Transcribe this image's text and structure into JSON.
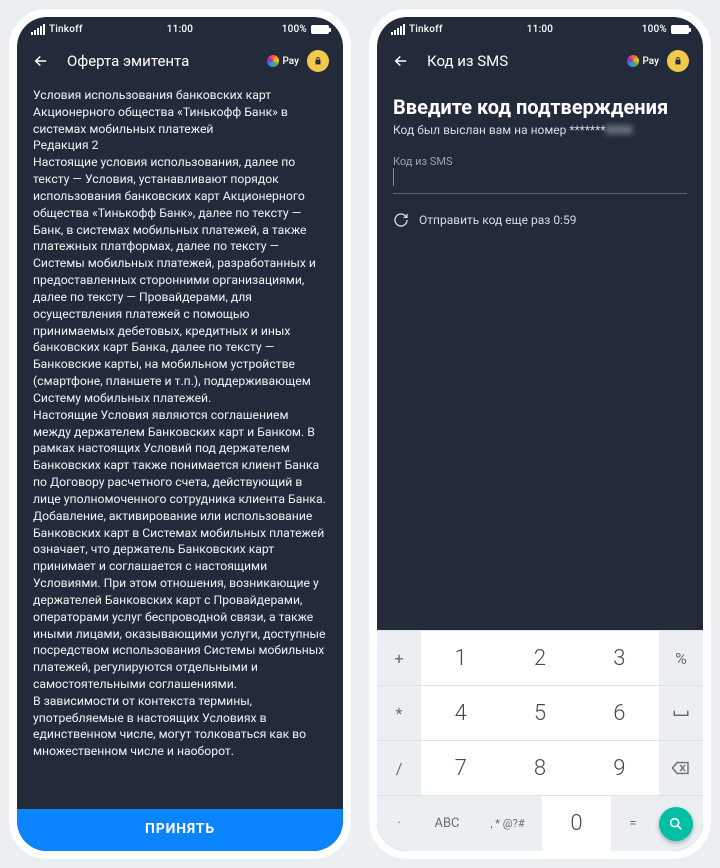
{
  "statusbar": {
    "carrier": "Tinkoff",
    "time": "11:00",
    "battery": "100%"
  },
  "left": {
    "title": "Оферта эмитента",
    "pay_label": "Pay",
    "body_p1": "Условия использования банковских карт Акционерного общества «Тинькофф Банк» в системах мобильных платежей",
    "body_p2": "Редакция 2",
    "body_p3": "Настоящие условия использования, далее по тексту — Условия, устанавливают порядок использования банковских карт Акционерного общества «Тинькофф Банк», далее по тексту — Банк, в системах мобильных платежей, а также платежных платформах, далее по тексту — Системы мобильных платежей, разработанных и предоставленных сторонними организациями, далее по тексту — Провайдерами, для осуществления платежей с помощью принимаемых дебетовых, кредитных и иных банковских карт Банка, далее по тексту — Банковские карты, на мобильном устройстве (смартфоне, планшете и т.п.), поддерживающем Систему мобильных платежей.",
    "body_p4": "Настоящие Условия являются соглашением между держателем Банковских карт и Банком. В рамках настоящих Условий под держателем Банковских карт также понимается клиент Банка по Договору расчетного счета, действующий в лице уполномоченного сотрудника клиента Банка. Добавление, активирование или использование Банковских карт в Системах мобильных платежей означает, что держатель Банковских карт принимает и соглашается с настоящими Условиями. При этом отношения, возникающие у держателей Банковских карт с Провайдерами, операторами услуг беспроводной связи, а также иными лицами, оказывающими услуги, доступные посредством использования Системы мобильных платежей, регулируются отдельными и самостоятельными соглашениями.",
    "body_p5": "В зависимости от контекста термины, употребляемые в настоящих Условиях в единственном числе, могут толковаться как во множественном числе и наоборот.",
    "accept": "ПРИНЯТЬ"
  },
  "right": {
    "title": "Код из SMS",
    "pay_label": "Pay",
    "heading": "Введите код подтверждения",
    "sub_prefix": "Код был выслан вам на номер ",
    "sub_masked": "*******",
    "sub_blur": "8888",
    "field_label": "Код из SMS",
    "resend": "Отправить код еще раз 0:59",
    "keys": {
      "r1": [
        "+",
        "1",
        "2",
        "3",
        "%"
      ],
      "r2": [
        "*",
        "4",
        "5",
        "6",
        "空"
      ],
      "r3": [
        "/",
        "7",
        "8",
        "9",
        "⌫"
      ],
      "r4": [
        "·",
        "ABC",
        ", * @?#",
        "0",
        "=",
        "🔍"
      ]
    }
  }
}
